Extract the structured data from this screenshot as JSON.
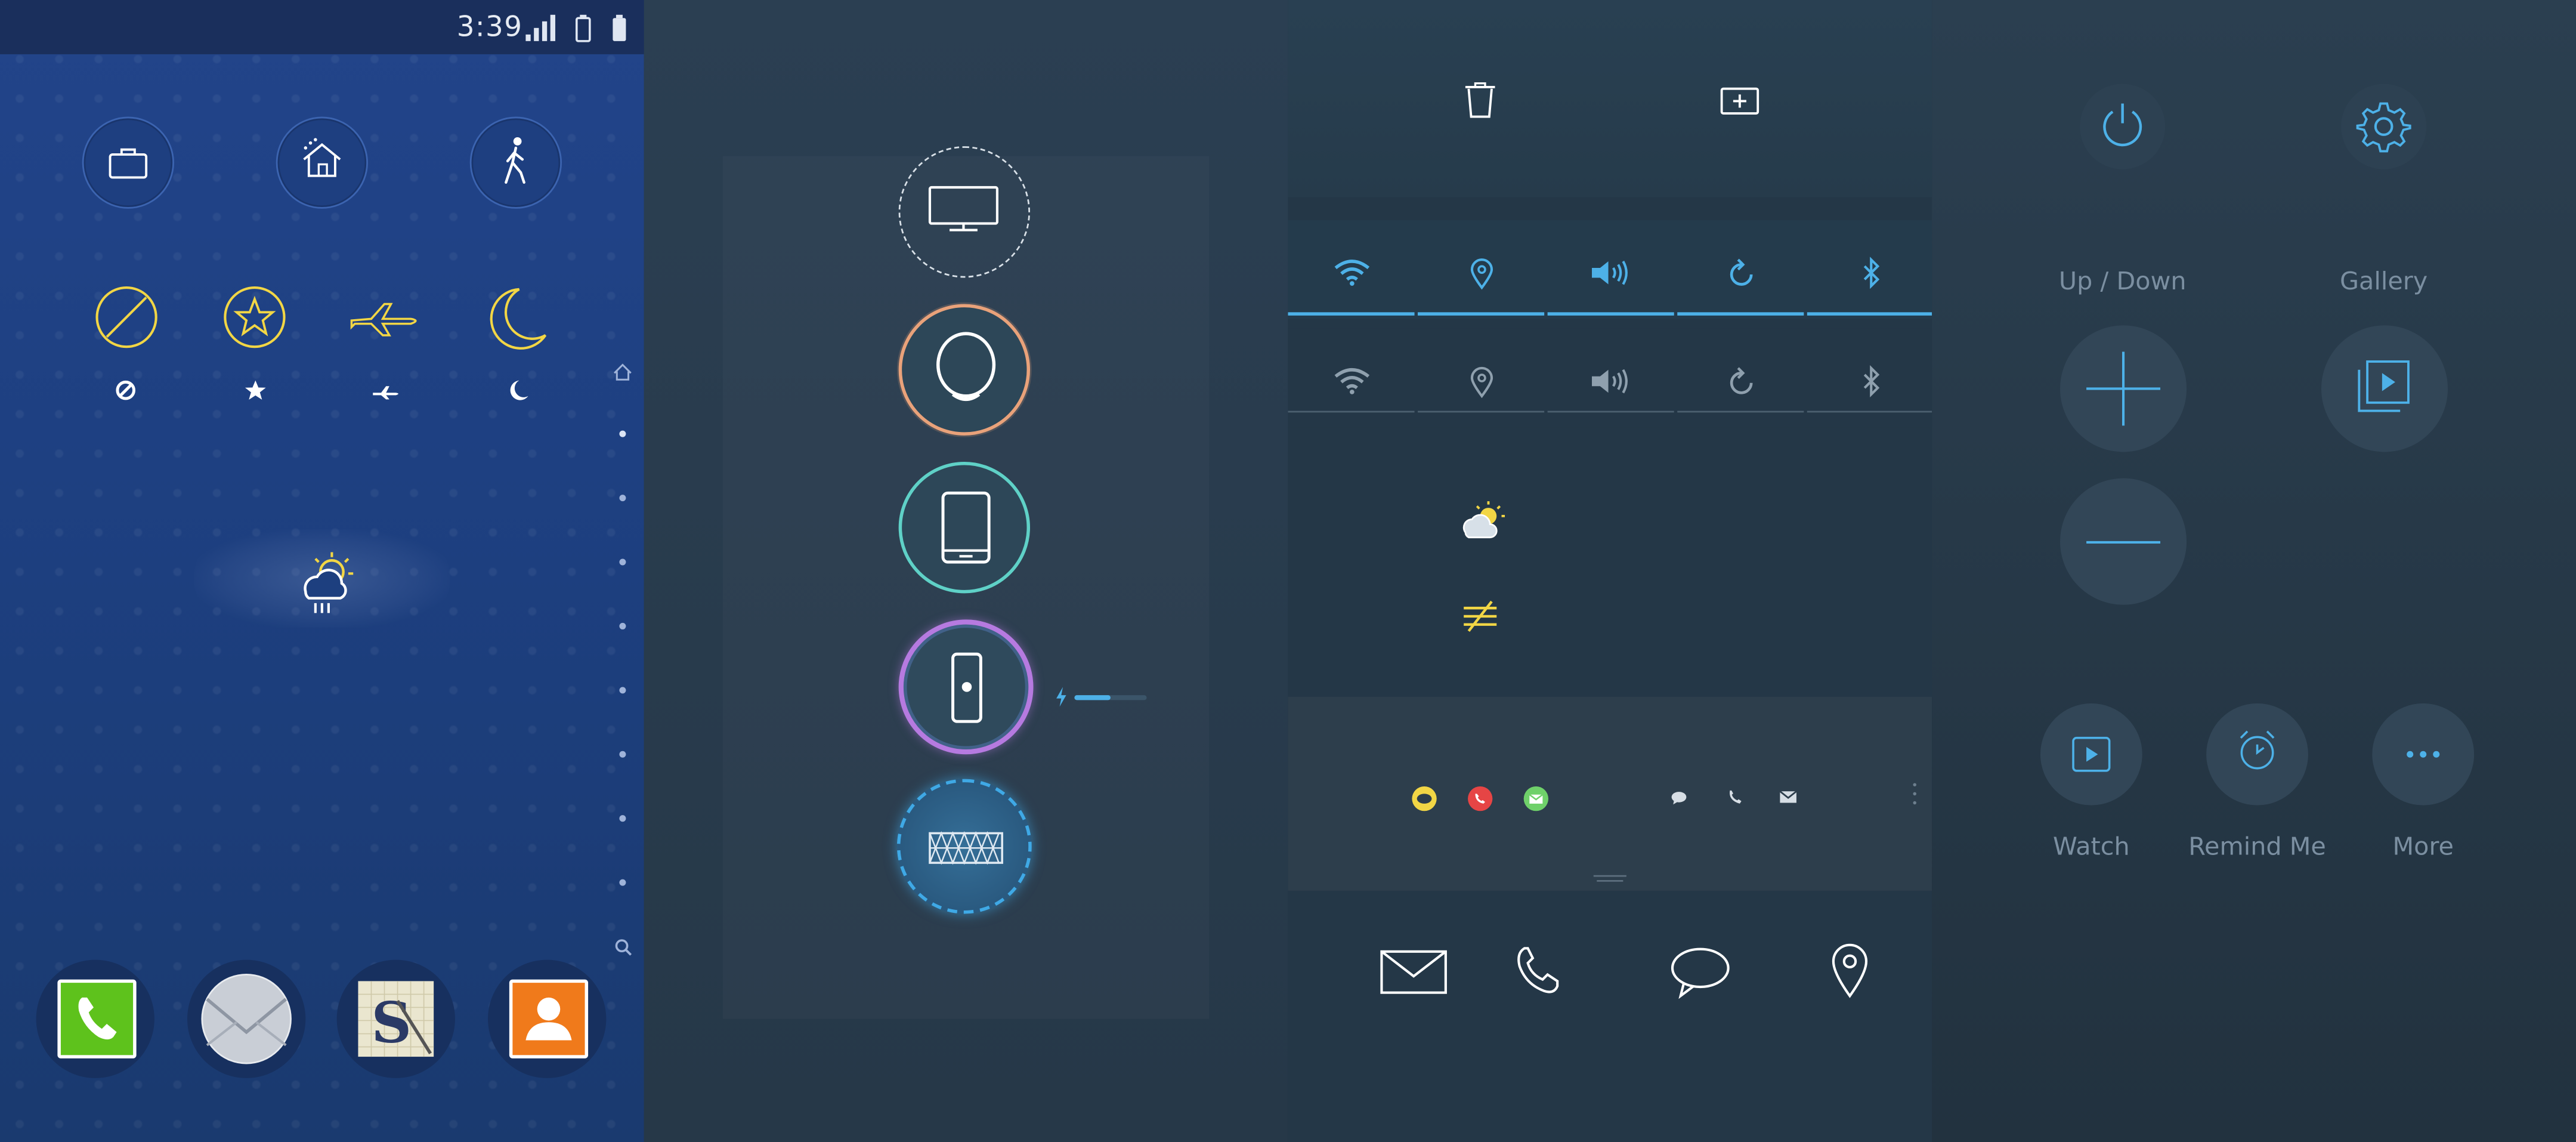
{
  "status_bar": {
    "time": "3:39",
    "icons": [
      "signal-icon",
      "battery-outline-icon",
      "battery-icon"
    ]
  },
  "home_screen": {
    "mode_buttons": [
      "briefcase-icon",
      "home-icon",
      "walking-person-icon"
    ],
    "quick_icons": [
      "no-entry-icon",
      "star-icon",
      "airplane-icon",
      "moon-icon"
    ],
    "weather_widget_icon": "weather-rain-sun-icon",
    "page_indicator": {
      "top_icon": "home-icon",
      "dots": 8,
      "bottom_icon": "search-icon"
    },
    "dock_apps": [
      "phone-app-icon",
      "email-app-icon",
      "s-note-app-icon",
      "contacts-app-icon"
    ]
  },
  "device_picker": {
    "devices": [
      "tv-icon",
      "watch-icon",
      "tablet-icon",
      "phone-device-icon",
      "speaker-icon"
    ],
    "colors": {
      "watch": "#e9a27a",
      "tablet": "#5fd1c7",
      "phone": "#b67ae0",
      "speaker": "#3fa9e6"
    },
    "charge_level": 0.5
  },
  "quick_settings": {
    "top_icons": [
      "trash-icon",
      "add-screen-icon"
    ],
    "toggles": [
      "wifi-icon",
      "location-icon",
      "sound-icon",
      "rotate-icon",
      "bluetooth-icon"
    ],
    "colors": {
      "active": "#4db1e8",
      "inactive": "#8fa0ae",
      "weather": "#f2d645",
      "notice": "#f2d645"
    },
    "notification_colored": [
      "message-dot-icon",
      "call-dot-icon",
      "email-dot-icon"
    ],
    "notification_plain": [
      "message-small-icon",
      "call-small-icon",
      "email-small-icon"
    ],
    "bottom_icons": [
      "envelope-icon",
      "phone-icon",
      "chat-bubble-icon",
      "map-pin-icon"
    ]
  },
  "controls": {
    "top_icons": [
      "power-icon",
      "settings-icon"
    ],
    "labels": {
      "up_down": "Up / Down",
      "gallery": "Gallery",
      "watch": "Watch",
      "remind_me": "Remind Me",
      "more": "More"
    },
    "accent": "#4db1e8"
  }
}
